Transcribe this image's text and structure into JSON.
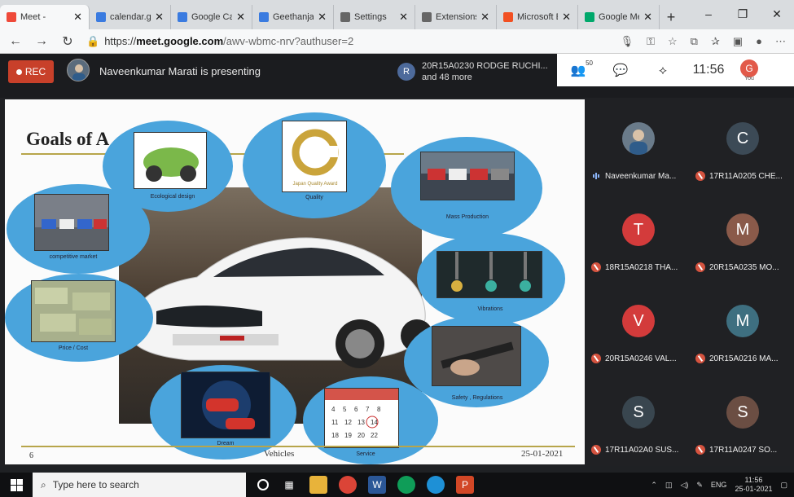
{
  "browser": {
    "tabs": [
      {
        "title": "Meet -",
        "fav": "#ef4a3a",
        "active": true
      },
      {
        "title": "calendar.go",
        "fav": "#3a7be0"
      },
      {
        "title": "Google Cale",
        "fav": "#3a7be0"
      },
      {
        "title": "Geethanjali",
        "fav": "#3a7be0"
      },
      {
        "title": "Settings",
        "fav": "#666666"
      },
      {
        "title": "Extensions",
        "fav": "#666666"
      },
      {
        "title": "Microsoft E",
        "fav": "#f25022"
      },
      {
        "title": "Google Mee",
        "fav": "#00a86b"
      }
    ],
    "newtab": "+",
    "win_min": "–",
    "win_max": "❐",
    "win_close": "✕",
    "url_prefix": "https://",
    "url_host": "meet.google.com",
    "url_path": "/awv-wbmc-nrv?authuser=2"
  },
  "meet": {
    "rec_label": "REC",
    "presenting_text": "Naveenkumar Marati is presenting",
    "chip_initial": "R",
    "chip_line1": "20R15A0230 RODGE RUCHI...",
    "chip_line2": "and 48 more",
    "participant_count": "50",
    "time": "11:56",
    "you_initial": "G",
    "you_label": "You"
  },
  "slide": {
    "title": "Goals of A",
    "labels": {
      "ecological": "Ecological design",
      "quality": "Quality",
      "mass": "Mass Production",
      "competitive": "competitive market",
      "price": "Price / Cost",
      "vibrations": "Vibrations",
      "safety": "Safety , Regulations",
      "dream": "Dream",
      "service": "Service"
    },
    "footer_num": "6",
    "footer_mid": "Vehicles",
    "footer_date": "25-01-2021"
  },
  "participants": [
    {
      "initial": "",
      "name": "Naveenkumar Ma...",
      "color": "#6a7b8a",
      "mic": "speaking"
    },
    {
      "initial": "C",
      "name": "17R11A0205 CHE...",
      "color": "#3c4a56",
      "mic": "off"
    },
    {
      "initial": "T",
      "name": "18R15A0218 THA...",
      "color": "#d33b3b",
      "mic": "off"
    },
    {
      "initial": "M",
      "name": "20R15A0235 MO...",
      "color": "#8a5a4a",
      "mic": "off"
    },
    {
      "initial": "V",
      "name": "20R15A0246 VAL...",
      "color": "#d33b3b",
      "mic": "off"
    },
    {
      "initial": "M",
      "name": "20R15A0216 MA...",
      "color": "#3e6f80",
      "mic": "off"
    },
    {
      "initial": "S",
      "name": "17R11A02A0 SUS...",
      "color": "#39464f",
      "mic": "off"
    },
    {
      "initial": "S",
      "name": "17R11A0247 SO...",
      "color": "#6b4e43",
      "mic": "off"
    }
  ],
  "taskbar": {
    "search_placeholder": "Type here to search",
    "lang": "ENG",
    "time": "11:56",
    "date": "25-01-2021"
  }
}
